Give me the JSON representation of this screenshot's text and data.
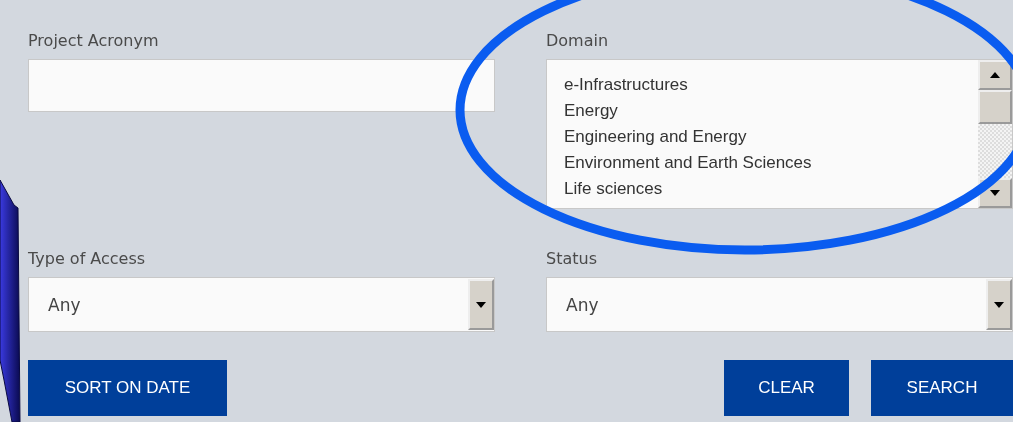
{
  "project_acronym": {
    "label": "Project Acronym"
  },
  "domain": {
    "label": "Domain",
    "options": [
      {
        "label": "e-Infrastructures",
        "selected": false
      },
      {
        "label": "Energy",
        "selected": false
      },
      {
        "label": "Engineering and Energy",
        "selected": false
      },
      {
        "label": "Environment and Earth Sciences",
        "selected": false
      },
      {
        "label": "Life sciences",
        "selected": false
      }
    ]
  },
  "type_of_access": {
    "label": "Type of Access",
    "value": "Any"
  },
  "status": {
    "label": "Status",
    "value": "Any"
  },
  "buttons": {
    "sort": "SORT ON DATE",
    "clear": "CLEAR",
    "search": "SEARCH"
  }
}
